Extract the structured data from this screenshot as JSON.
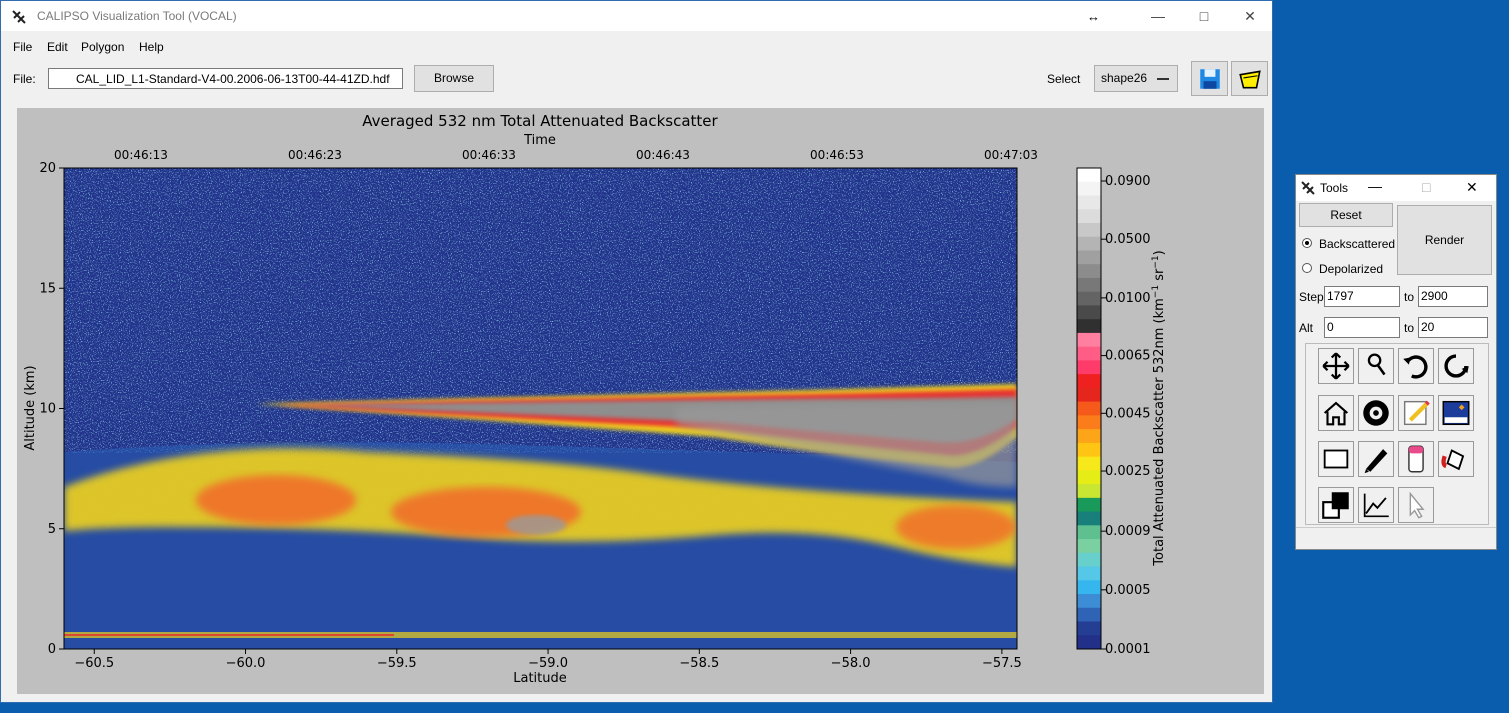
{
  "main_window": {
    "title": "CALIPSO Visualization Tool (VOCAL)",
    "menu": [
      "File",
      "Edit",
      "Polygon",
      "Help"
    ],
    "file_label": "File:",
    "file_value": "CAL_LID_L1-Standard-V4-00.2006-06-13T00-44-41ZD.hdf",
    "browse_label": "Browse",
    "select_label": "Select",
    "select_value": "shape26",
    "icons": [
      "save-icon",
      "open-folder-icon"
    ]
  },
  "plot": {
    "title": "Averaged 532 nm Total Attenuated Backscatter",
    "top_axis_label": "Time",
    "time_ticks": [
      "00:46:13",
      "00:46:23",
      "00:46:33",
      "00:46:43",
      "00:46:53",
      "00:47:03"
    ],
    "bottom_axis_label": "Latitude",
    "latitude_ticks": [
      "−60.5",
      "−60.0",
      "−59.5",
      "−59.0",
      "−58.5",
      "−58.0",
      "−57.5"
    ],
    "y_axis_label": "Altitude (km)",
    "altitude_ticks": [
      "0",
      "5",
      "10",
      "15",
      "20"
    ],
    "ylim": [
      0,
      20
    ],
    "xlim": [
      -60.6,
      -57.45
    ],
    "colorbar_label": "Total Attenuated Backscatter 532nm (km",
    "colorbar_label_unit_sup1": "−1",
    "colorbar_label_unit_mid": " sr",
    "colorbar_label_unit_sup2": "−1",
    "colorbar_label_unit_end": ")",
    "colorbar_ticks": [
      "0.0900",
      "0.0500",
      "0.0100",
      "0.0065",
      "0.0045",
      "0.0025",
      "0.0009",
      "0.0005",
      "0.0001"
    ],
    "colorbar_colors": [
      "#ffffff",
      "#f4f4f4",
      "#e8e8e8",
      "#dcdcdc",
      "#c8c8c8",
      "#b4b4b4",
      "#a0a0a0",
      "#8c8c8c",
      "#787878",
      "#646464",
      "#4a4a4a",
      "#303030",
      "#ff7fa0",
      "#ff5d85",
      "#ff3b6a",
      "#ee2020",
      "#e4261c",
      "#f55a1b",
      "#fb7c1a",
      "#fda518",
      "#ffc414",
      "#f6e81a",
      "#e6ec16",
      "#c9e632",
      "#199a5a",
      "#197f7a",
      "#5dc08e",
      "#7ad0a0",
      "#68d0cc",
      "#54c8e6",
      "#36b6ee",
      "#3c8cd6",
      "#2e63b6",
      "#243e94",
      "#22308a"
    ]
  },
  "tools_window": {
    "title": "Tools",
    "reset_label": "Reset",
    "render_label": "Render",
    "radio_backscattered": "Backscattered",
    "radio_depolarized": "Depolarized",
    "selected_mode": "Backscattered",
    "step_label": "Step",
    "step_from": "1797",
    "step_to_label": "to",
    "step_to": "2900",
    "alt_label": "Alt",
    "alt_from": "0",
    "alt_to_label": "to",
    "alt_to": "20",
    "tool_icons": [
      "move-icon",
      "zoom-icon",
      "undo-icon",
      "redo-icon",
      "home-icon",
      "settings-icon",
      "edit-note-icon",
      "image-icon",
      "rectangle-icon",
      "pencil-icon",
      "eraser-icon",
      "paint-bucket-icon",
      "color-swatch-icon",
      "chart-icon",
      "pointer-icon"
    ]
  }
}
